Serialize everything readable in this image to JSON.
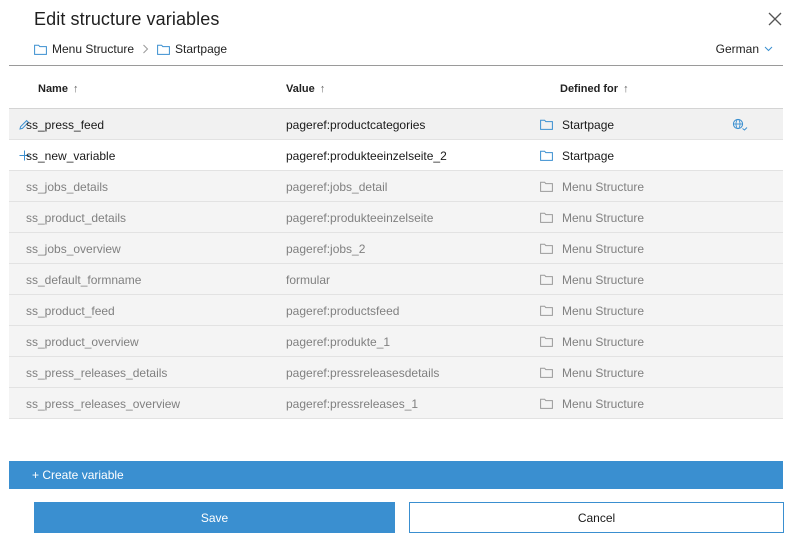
{
  "dialog": {
    "title": "Edit structure variables",
    "close_icon": "close-icon"
  },
  "breadcrumb": {
    "items": [
      {
        "label": "Menu Structure",
        "icon": "folder-icon"
      },
      {
        "label": "Startpage",
        "icon": "folder-icon"
      }
    ],
    "separator_icon": "chevron-right-icon"
  },
  "language": {
    "selected": "German",
    "icon": "chevron-down-icon"
  },
  "table": {
    "columns": [
      {
        "label": "Name",
        "sort_icon": "sort-arrow-up-icon"
      },
      {
        "label": "Value",
        "sort_icon": "sort-arrow-up-icon"
      },
      {
        "label": "Defined for",
        "sort_icon": "sort-arrow-up-icon"
      }
    ],
    "rows": [
      {
        "name": "ss_press_feed",
        "value": "pageref:productcategories",
        "defined_for": "Startpage",
        "state": "edit",
        "row_icon": "pencil-icon",
        "lang_icon": "language-globe-icon"
      },
      {
        "name": "ss_new_variable",
        "value": "pageref:produkteeinzelseite_2",
        "defined_for": "Startpage",
        "state": "new",
        "row_icon": "plus-icon"
      },
      {
        "name": "ss_jobs_details",
        "value": "pageref:jobs_detail",
        "defined_for": "Menu Structure",
        "state": "inherited"
      },
      {
        "name": "ss_product_details",
        "value": "pageref:produkteeinzelseite",
        "defined_for": "Menu Structure",
        "state": "inherited"
      },
      {
        "name": "ss_jobs_overview",
        "value": "pageref:jobs_2",
        "defined_for": "Menu Structure",
        "state": "inherited"
      },
      {
        "name": "ss_default_formname",
        "value": "formular",
        "defined_for": "Menu Structure",
        "state": "inherited"
      },
      {
        "name": "ss_product_feed",
        "value": "pageref:productsfeed",
        "defined_for": "Menu Structure",
        "state": "inherited"
      },
      {
        "name": "ss_product_overview",
        "value": "pageref:produkte_1",
        "defined_for": "Menu Structure",
        "state": "inherited"
      },
      {
        "name": "ss_press_releases_details",
        "value": "pageref:pressreleasesdetails",
        "defined_for": "Menu Structure",
        "state": "inherited"
      },
      {
        "name": "ss_press_releases_overview",
        "value": "pageref:pressreleases_1",
        "defined_for": "Menu Structure",
        "state": "inherited"
      }
    ]
  },
  "actions": {
    "create_label": "+ Create variable",
    "save_label": "Save",
    "cancel_label": "Cancel"
  },
  "colors": {
    "accent": "#3a8fd0",
    "inherited_row_bg": "#f4f4f4",
    "inherited_text": "#808080"
  }
}
